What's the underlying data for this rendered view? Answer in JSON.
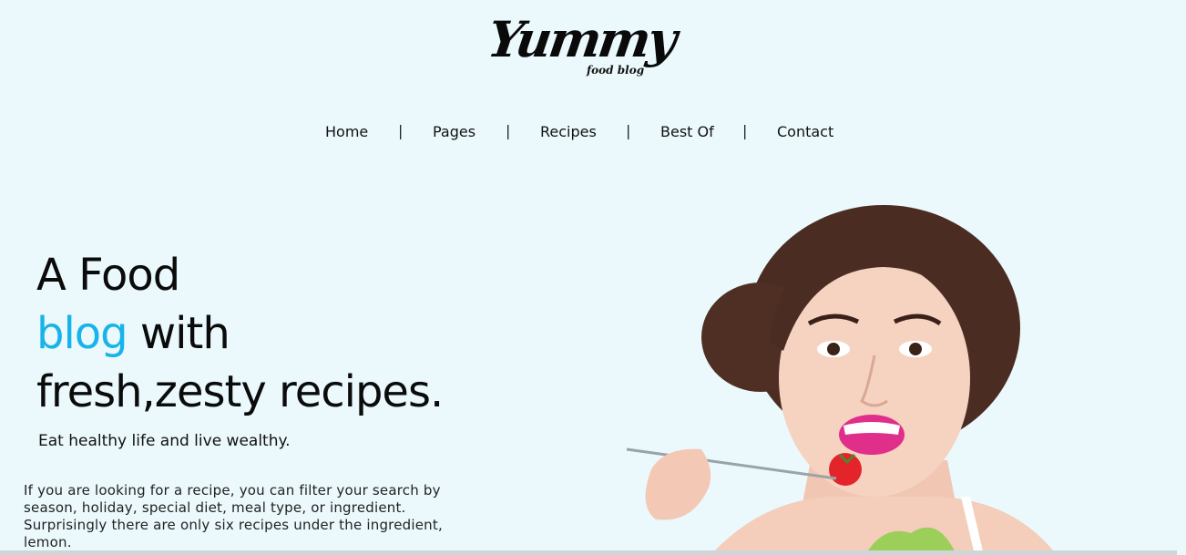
{
  "logo": {
    "main": "Yummy",
    "sub": "food blog"
  },
  "nav": {
    "items": [
      "Home",
      "Pages",
      "Recipes",
      "Best Of",
      "Contact"
    ],
    "separator": "|"
  },
  "hero": {
    "title_line1": "A Food",
    "title_accent": "blog",
    "title_line2_rest": " with",
    "title_line3": "fresh,zesty recipes.",
    "tagline": "Eat healthy life and live wealthy.",
    "description": "If you are looking for a recipe, you can filter your search by season, holiday, special diet, meal type, or ingredient. Surprisingly there are only six recipes under the ingredient, lemon.",
    "image": "woman-eating-salad-illustration"
  },
  "colors": {
    "background": "#ebf9fc",
    "accent": "#18b3e9",
    "text": "#111111"
  }
}
